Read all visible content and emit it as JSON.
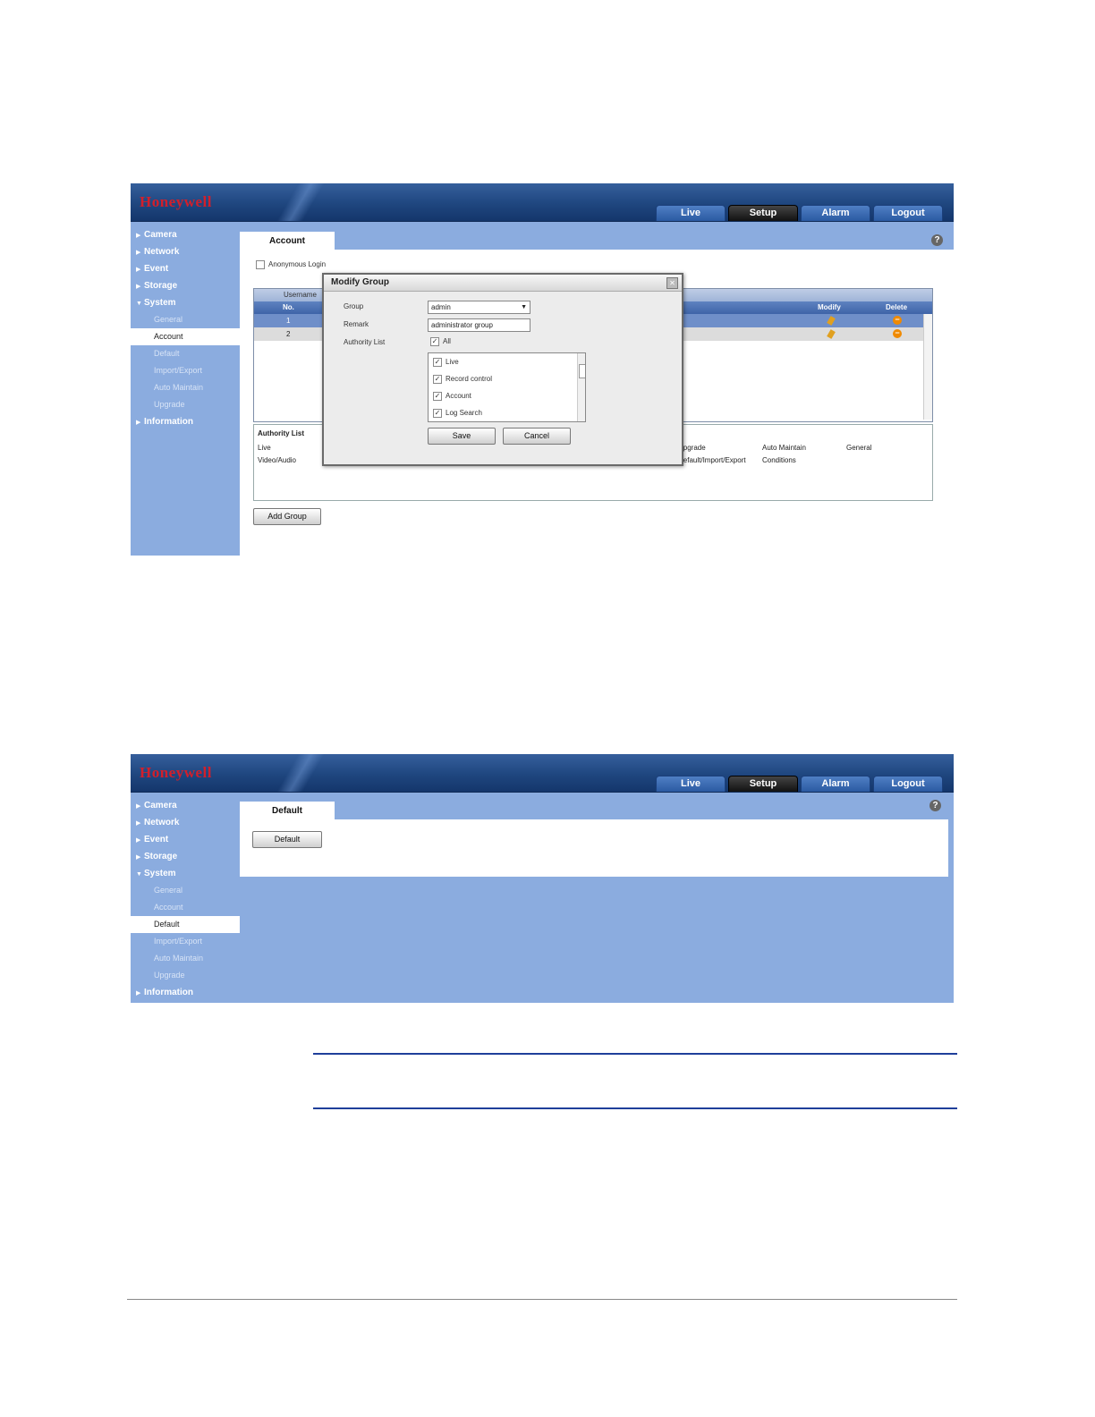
{
  "screens": [
    {
      "brand": {
        "logo_text": "Honeywell"
      },
      "tabs": [
        "Live",
        "Setup",
        "Alarm",
        "Logout"
      ],
      "active_tab": "Setup",
      "sidebar": {
        "items": [
          {
            "label": "Camera"
          },
          {
            "label": "Network"
          },
          {
            "label": "Event"
          },
          {
            "label": "Storage"
          },
          {
            "label": "System"
          },
          {
            "label": "Information"
          }
        ],
        "system_subitems": [
          "General",
          "Account",
          "Default",
          "Import/Export",
          "Auto Maintain",
          "Upgrade"
        ],
        "selected_subitem": "Account"
      },
      "panel": {
        "tab_label": "Account",
        "anonymous_login": "Anonymous Login",
        "table": {
          "headers": {
            "username": "Username",
            "no": "No.",
            "modify": "Modify",
            "delete": "Delete"
          },
          "rows": [
            {
              "no": "1"
            },
            {
              "no": "2"
            }
          ]
        },
        "authority": {
          "title": "Authority List",
          "items_left": [
            "Live",
            "Video/Audio"
          ],
          "items_col1": [
            "Upgrade",
            "Default/Import/Export"
          ],
          "items_col2": [
            "Auto Maintain",
            "Conditions"
          ],
          "items_col3": [
            "General"
          ]
        },
        "add_group_button": "Add Group"
      },
      "modal": {
        "title": "Modify Group",
        "group_label": "Group",
        "group_value": "admin",
        "remark_label": "Remark",
        "remark_value": "administrator group",
        "authority_label": "Authority List",
        "all_label": "All",
        "list_items": [
          "Live",
          "Record control",
          "Account",
          "Log Search"
        ],
        "save_button": "Save",
        "cancel_button": "Cancel"
      }
    },
    {
      "brand": {
        "logo_text": "Honeywell"
      },
      "tabs": [
        "Live",
        "Setup",
        "Alarm",
        "Logout"
      ],
      "active_tab": "Setup",
      "sidebar": {
        "items": [
          {
            "label": "Camera"
          },
          {
            "label": "Network"
          },
          {
            "label": "Event"
          },
          {
            "label": "Storage"
          },
          {
            "label": "System"
          },
          {
            "label": "Information"
          }
        ],
        "system_subitems": [
          "General",
          "Account",
          "Default",
          "Import/Export",
          "Auto Maintain",
          "Upgrade"
        ],
        "selected_subitem": "Default"
      },
      "panel": {
        "tab_label": "Default",
        "default_button": "Default"
      }
    }
  ],
  "colors": {
    "header": "#1f467f",
    "background": "#8bacdf",
    "brand_red": "#d21f2b",
    "rule_blue": "#1f3f9a"
  },
  "icons": [
    "help-icon",
    "close-icon",
    "pencil-icon",
    "minus-icon",
    "arrow-right-icon",
    "arrow-down-icon",
    "dropdown-arrow-icon"
  ]
}
